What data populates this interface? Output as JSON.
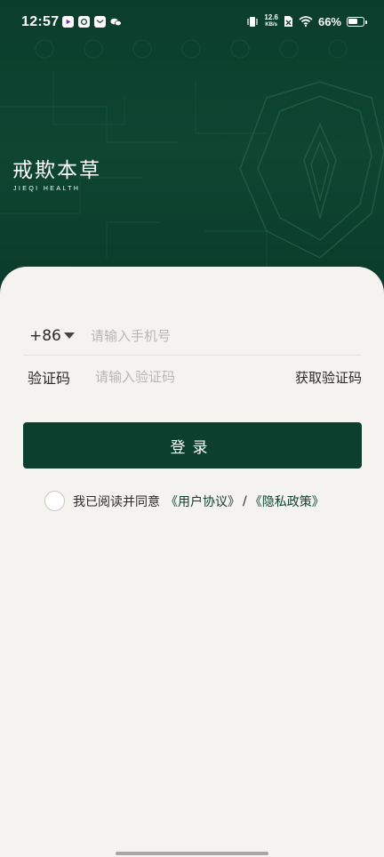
{
  "status_bar": {
    "time": "12:57",
    "net_speed_value": "12.6",
    "net_speed_unit": "KB/s",
    "battery_percent": "66%",
    "battery_level": 0.66
  },
  "brand": {
    "name_cn": "戒欺本草",
    "name_en": "JIEQI HEALTH"
  },
  "form": {
    "country_code": "+86",
    "phone_placeholder": "请输入手机号",
    "code_label": "验证码",
    "code_placeholder": "请输入验证码",
    "get_code_label": "获取验证码",
    "login_label": "登录"
  },
  "agreement": {
    "prefix": "我已阅读并同意",
    "user_agreement": "《用户协议》",
    "separator": "/",
    "privacy_policy": "《隐私政策》"
  },
  "colors": {
    "brand_green": "#0c3f2d",
    "background": "#f5f3ef"
  }
}
